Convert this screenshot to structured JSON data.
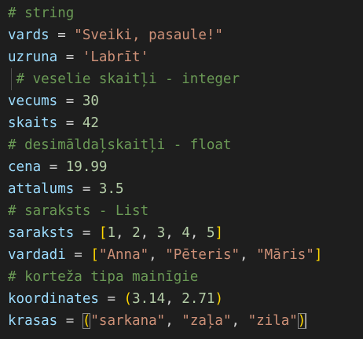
{
  "theme": {
    "background": "#1e1e1e",
    "comment": "#6a9955",
    "variable": "#9cdcfe",
    "operator": "#d4d4d4",
    "string": "#ce9178",
    "number": "#b5cea8",
    "bracket_level1": "#ffd700",
    "bracket_level2": "#da70d6"
  },
  "lines": [
    {
      "name": "line-comment-string",
      "tokens": [
        {
          "t": "comment",
          "v": "# string"
        }
      ]
    },
    {
      "name": "line-vards",
      "tokens": [
        {
          "t": "variable",
          "v": "vards"
        },
        {
          "t": "operator",
          "v": " = "
        },
        {
          "t": "string",
          "v": "\"Sveiki, pasaule!\""
        }
      ]
    },
    {
      "name": "line-uzruna",
      "tokens": [
        {
          "t": "variable",
          "v": "uzruna"
        },
        {
          "t": "operator",
          "v": " = "
        },
        {
          "t": "string",
          "v": "'Labrīt'"
        }
      ]
    },
    {
      "name": "line-comment-integer",
      "tokens": [
        {
          "t": "comment",
          "v": " # veselie skaitļi - integer"
        }
      ]
    },
    {
      "name": "line-vecums",
      "tokens": [
        {
          "t": "variable",
          "v": "vecums"
        },
        {
          "t": "operator",
          "v": " = "
        },
        {
          "t": "number",
          "v": "30"
        }
      ]
    },
    {
      "name": "line-skaits",
      "tokens": [
        {
          "t": "variable",
          "v": "skaits"
        },
        {
          "t": "operator",
          "v": " = "
        },
        {
          "t": "number",
          "v": "42"
        }
      ]
    },
    {
      "name": "line-comment-float",
      "tokens": [
        {
          "t": "comment",
          "v": "# desimāldaļskaitļi - float"
        }
      ]
    },
    {
      "name": "line-cena",
      "tokens": [
        {
          "t": "variable",
          "v": "cena"
        },
        {
          "t": "operator",
          "v": " = "
        },
        {
          "t": "number",
          "v": "19.99"
        }
      ]
    },
    {
      "name": "line-attalums",
      "tokens": [
        {
          "t": "variable",
          "v": "attalums"
        },
        {
          "t": "operator",
          "v": " = "
        },
        {
          "t": "number",
          "v": "3.5"
        }
      ]
    },
    {
      "name": "line-comment-list",
      "tokens": [
        {
          "t": "comment",
          "v": "# saraksts - List"
        }
      ]
    },
    {
      "name": "line-saraksts",
      "tokens": [
        {
          "t": "variable",
          "v": "saraksts"
        },
        {
          "t": "operator",
          "v": " = "
        },
        {
          "t": "bracket1",
          "v": "["
        },
        {
          "t": "number",
          "v": "1"
        },
        {
          "t": "punct",
          "v": ", "
        },
        {
          "t": "number",
          "v": "2"
        },
        {
          "t": "punct",
          "v": ", "
        },
        {
          "t": "number",
          "v": "3"
        },
        {
          "t": "punct",
          "v": ", "
        },
        {
          "t": "number",
          "v": "4"
        },
        {
          "t": "punct",
          "v": ", "
        },
        {
          "t": "number",
          "v": "5"
        },
        {
          "t": "bracket1",
          "v": "]"
        }
      ]
    },
    {
      "name": "line-vardadi",
      "tokens": [
        {
          "t": "variable",
          "v": "vardadi"
        },
        {
          "t": "operator",
          "v": " = "
        },
        {
          "t": "bracket1",
          "v": "["
        },
        {
          "t": "string",
          "v": "\"Anna\""
        },
        {
          "t": "punct",
          "v": ", "
        },
        {
          "t": "string",
          "v": "\"Pēteris\""
        },
        {
          "t": "punct",
          "v": ", "
        },
        {
          "t": "string",
          "v": "\"Māris\""
        },
        {
          "t": "bracket1",
          "v": "]"
        }
      ]
    },
    {
      "name": "line-comment-tuple",
      "tokens": [
        {
          "t": "comment",
          "v": "# korteža tipa mainīgie"
        }
      ]
    },
    {
      "name": "line-koordinates",
      "tokens": [
        {
          "t": "variable",
          "v": "koordinates"
        },
        {
          "t": "operator",
          "v": " = "
        },
        {
          "t": "bracket1",
          "v": "("
        },
        {
          "t": "number",
          "v": "3.14"
        },
        {
          "t": "punct",
          "v": ", "
        },
        {
          "t": "number",
          "v": "2.71"
        },
        {
          "t": "bracket1",
          "v": ")"
        }
      ]
    },
    {
      "name": "line-krasas",
      "tokens": [
        {
          "t": "variable",
          "v": "krasas"
        },
        {
          "t": "operator",
          "v": " = "
        },
        {
          "t": "bracket1-match",
          "v": "("
        },
        {
          "t": "string",
          "v": "\"sarkana\""
        },
        {
          "t": "punct",
          "v": ", "
        },
        {
          "t": "string",
          "v": "\"zaļa\""
        },
        {
          "t": "punct",
          "v": ", "
        },
        {
          "t": "string",
          "v": "\"zila\""
        },
        {
          "t": "bracket1-match",
          "v": ")"
        },
        {
          "t": "cursor",
          "v": ""
        }
      ]
    }
  ]
}
